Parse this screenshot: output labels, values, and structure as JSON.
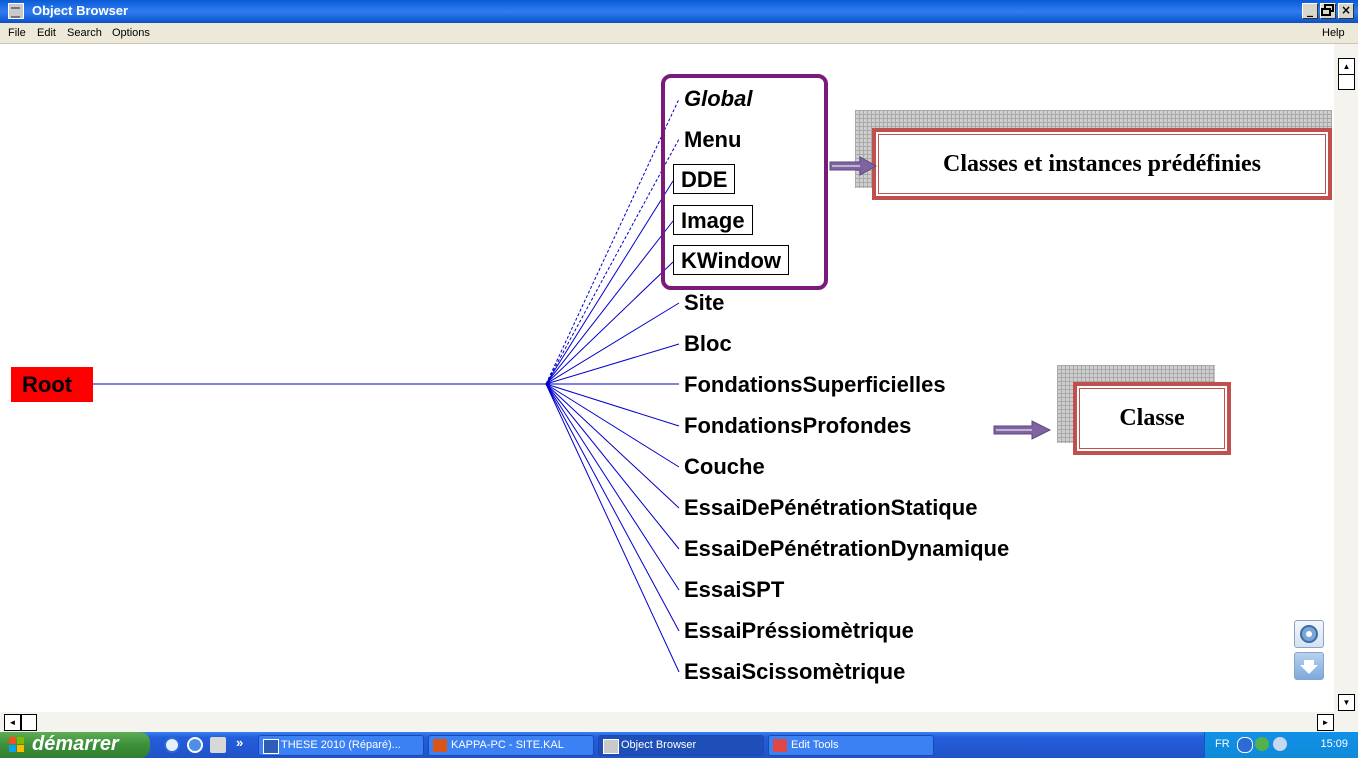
{
  "window": {
    "title": "Object Browser",
    "controls": {
      "minimize": "_",
      "restore": "ф",
      "close": "×"
    }
  },
  "menubar": {
    "items": [
      "File",
      "Edit",
      "Search",
      "Options"
    ],
    "help": "Help"
  },
  "tree": {
    "root": "Root",
    "children": [
      "Global",
      "Menu",
      "DDE",
      "Image",
      "KWindow",
      "Site",
      "Bloc",
      "FondationsSuperficielles",
      "FondationsProfondes",
      "Couche",
      "EssaiDePénétrationStatique",
      "EssaiDePénétrationDynamique",
      "EssaiSPT",
      "EssaiPréssiomètrique",
      "EssaiScissomètrique"
    ]
  },
  "annotations": {
    "predefined": "Classes et instances prédéfinies",
    "classe": "Classe"
  },
  "taskbar": {
    "start": "démarrer",
    "overflow": "»",
    "tasks": [
      {
        "label": "THESE 2010 (Réparé)..."
      },
      {
        "label": "KAPPA-PC - SITE.KAL"
      },
      {
        "label": "Object Browser"
      },
      {
        "label": "Edit Tools"
      }
    ],
    "tray": {
      "language": "FR",
      "time": "15:09"
    }
  },
  "colors": {
    "root_fill": "#ff0000",
    "tree_lines": "#0000cc",
    "frame_purple": "#7a1a7c",
    "callout_border": "#c0504d",
    "arrow_fill": "#8064a2"
  }
}
